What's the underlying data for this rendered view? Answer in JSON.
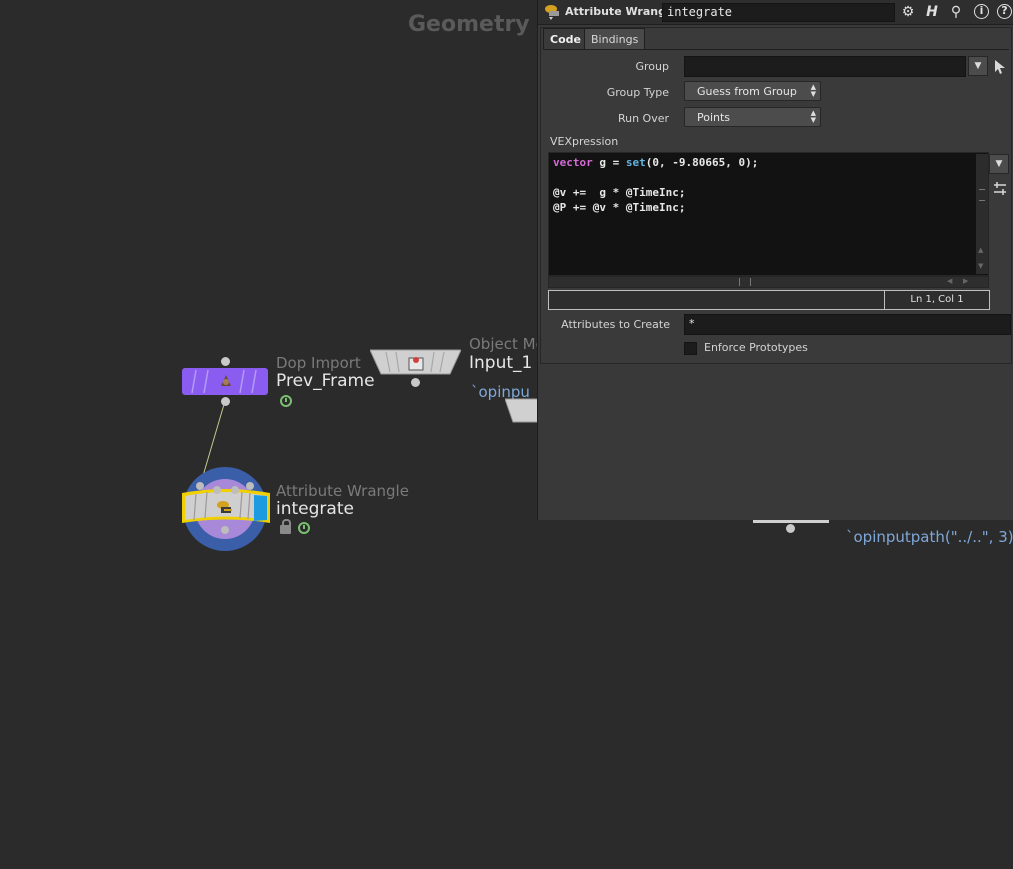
{
  "network": {
    "context_title": "Geometry",
    "nodes": {
      "dop_import": {
        "type_label": "Dop Import",
        "name": "Prev_Frame",
        "color": "#8b5cf0"
      },
      "object_merge": {
        "type_label": "Object Me",
        "name": "Input_1",
        "path": "`opinputpath(\"../..\", 3)`",
        "path_truncated": "`opinpu"
      },
      "attribute_wrangle": {
        "type_label": "Attribute Wrangle",
        "name": "integrate",
        "selected_color": "#f0d000"
      }
    }
  },
  "param_pane": {
    "header": {
      "node_type": "Attribute Wrangle",
      "node_name": "integrate"
    },
    "tabs": [
      {
        "label": "Code"
      },
      {
        "label": "Bindings"
      }
    ],
    "group": {
      "label": "Group",
      "value": ""
    },
    "group_type": {
      "label": "Group Type",
      "value": "Guess from Group"
    },
    "run_over": {
      "label": "Run Over",
      "value": "Points"
    },
    "vexpression": {
      "label": "VEXpression",
      "lines": [
        "vector g = set(0, -9.80665, 0);",
        "",
        "@v +=  g * @TimeInc;",
        "@P += @v * @TimeInc;"
      ]
    },
    "status": {
      "cursor_position": "Ln 1, Col 1"
    },
    "attributes_to_create": {
      "label": "Attributes to Create",
      "value": "*"
    },
    "enforce_prototypes": {
      "label": "Enforce Prototypes",
      "checked": false
    }
  }
}
